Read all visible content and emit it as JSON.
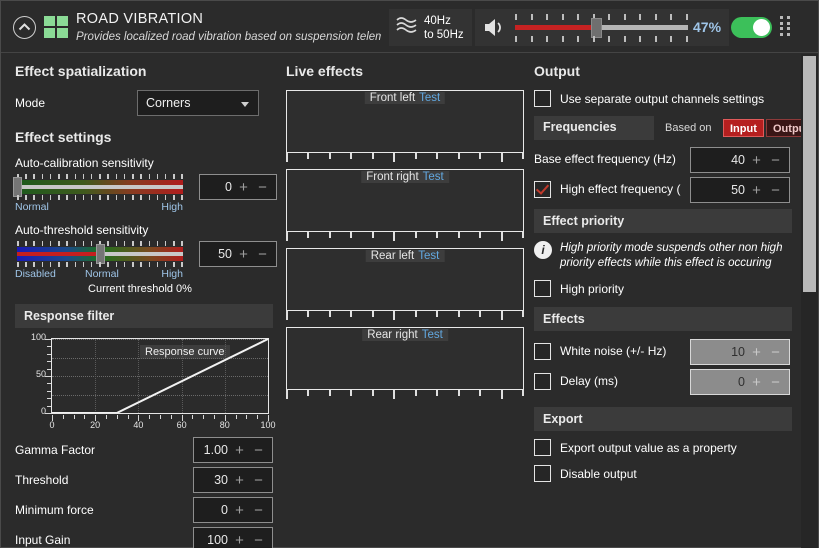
{
  "header": {
    "title": "ROAD VIBRATION",
    "subtitle": "Provides localized road vibration based on suspension telem",
    "collapse_icon": "chevron-up-icon",
    "grid_icon": "grid-2x2-icon",
    "wave_icon": "waveform-icon",
    "freq_line1": "40Hz",
    "freq_line2": "to 50Hz",
    "speaker_icon": "speaker-icon",
    "volume_percent": "47%",
    "volume_value": 47,
    "toggle_on": true,
    "drag_icon": "drag-handle-icon",
    "accent_green": "#3cc05a",
    "accent_red": "#c62222"
  },
  "left": {
    "spatialization_title": "Effect spatialization",
    "mode_label": "Mode",
    "mode_value": "Corners",
    "mode_options": [
      "Corners"
    ],
    "settings_title": "Effect settings",
    "autocal": {
      "label": "Auto-calibration sensitivity",
      "value": "0",
      "min_caption": "Normal",
      "max_caption": "High",
      "thumb_percent": 0
    },
    "autothresh": {
      "label": "Auto-threshold sensitivity",
      "value": "50",
      "captions": [
        "Disabled",
        "Normal",
        "High"
      ],
      "thumb_percent": 50,
      "current_threshold": "Current threshold 0%"
    },
    "response_filter_title": "Response filter",
    "fields": [
      {
        "label": "Gamma Factor",
        "value": "1.00"
      },
      {
        "label": "Threshold",
        "value": "30"
      },
      {
        "label": "Minimum force",
        "value": "0"
      },
      {
        "label": "Input Gain",
        "value": "100"
      }
    ]
  },
  "chart_data": {
    "type": "line",
    "title": "Response curve",
    "xlabel": "",
    "ylabel": "",
    "xlim": [
      0,
      100
    ],
    "ylim": [
      0,
      100
    ],
    "xticks": [
      0,
      20,
      40,
      60,
      80,
      100
    ],
    "yticks": [
      0,
      50,
      100
    ],
    "grid": true,
    "series": [
      {
        "name": "Response curve",
        "x": [
          0,
          30,
          100
        ],
        "y": [
          0,
          0,
          100
        ]
      }
    ]
  },
  "middle": {
    "title": "Live effects",
    "test_label": "Test",
    "panels": [
      {
        "name": "Front left"
      },
      {
        "name": "Front right"
      },
      {
        "name": "Rear left"
      },
      {
        "name": "Rear right"
      }
    ]
  },
  "right": {
    "output_title": "Output",
    "separate_channels": {
      "label": "Use separate output channels settings",
      "checked": false
    },
    "frequencies": {
      "title": "Frequencies",
      "based_on_label": "Based on",
      "input_label": "Input",
      "output_label": "Output",
      "selected": "Input"
    },
    "base_freq": {
      "label": "Base effect frequency (Hz)",
      "value": "40"
    },
    "high_freq": {
      "label": "High effect frequency (",
      "value": "50",
      "checked": true
    },
    "priority": {
      "title": "Effect priority",
      "info_icon": "info-icon",
      "info_text": "High priority mode suspends other non high priority effects while this effect is occuring",
      "checkbox": {
        "label": "High priority",
        "checked": false
      }
    },
    "effects": {
      "title": "Effects",
      "items": [
        {
          "label": "White noise (+/- Hz)",
          "value": "10",
          "checked": false,
          "disabled": true
        },
        {
          "label": "Delay (ms)",
          "value": "0",
          "checked": false,
          "disabled": true
        }
      ]
    },
    "export": {
      "title": "Export",
      "items": [
        {
          "label": "Export output value as a property",
          "checked": false
        },
        {
          "label": "Disable output",
          "checked": false
        }
      ]
    }
  }
}
